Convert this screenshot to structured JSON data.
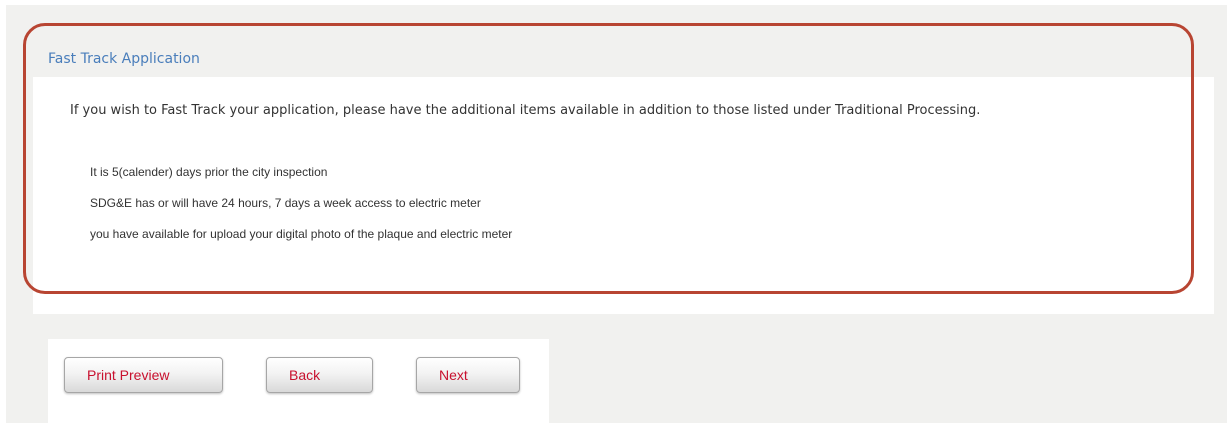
{
  "section": {
    "title": "Fast Track Application",
    "intro": "If you wish to Fast Track your application, please have the additional items available in addition to those listed under Traditional Processing.",
    "requirements": [
      "It is 5(calender) days prior the city inspection",
      "SDG&E has or will have 24 hours, 7 days a week access to electric meter",
      "you have available for upload your digital photo of the plaque and electric meter"
    ]
  },
  "buttons": {
    "print_preview": "Print Preview",
    "back": "Back",
    "next": "Next"
  },
  "colors": {
    "title": "#4a7ebb",
    "button_text": "#c8102e",
    "highlight": "#b84532",
    "background": "#f1f1ef"
  }
}
